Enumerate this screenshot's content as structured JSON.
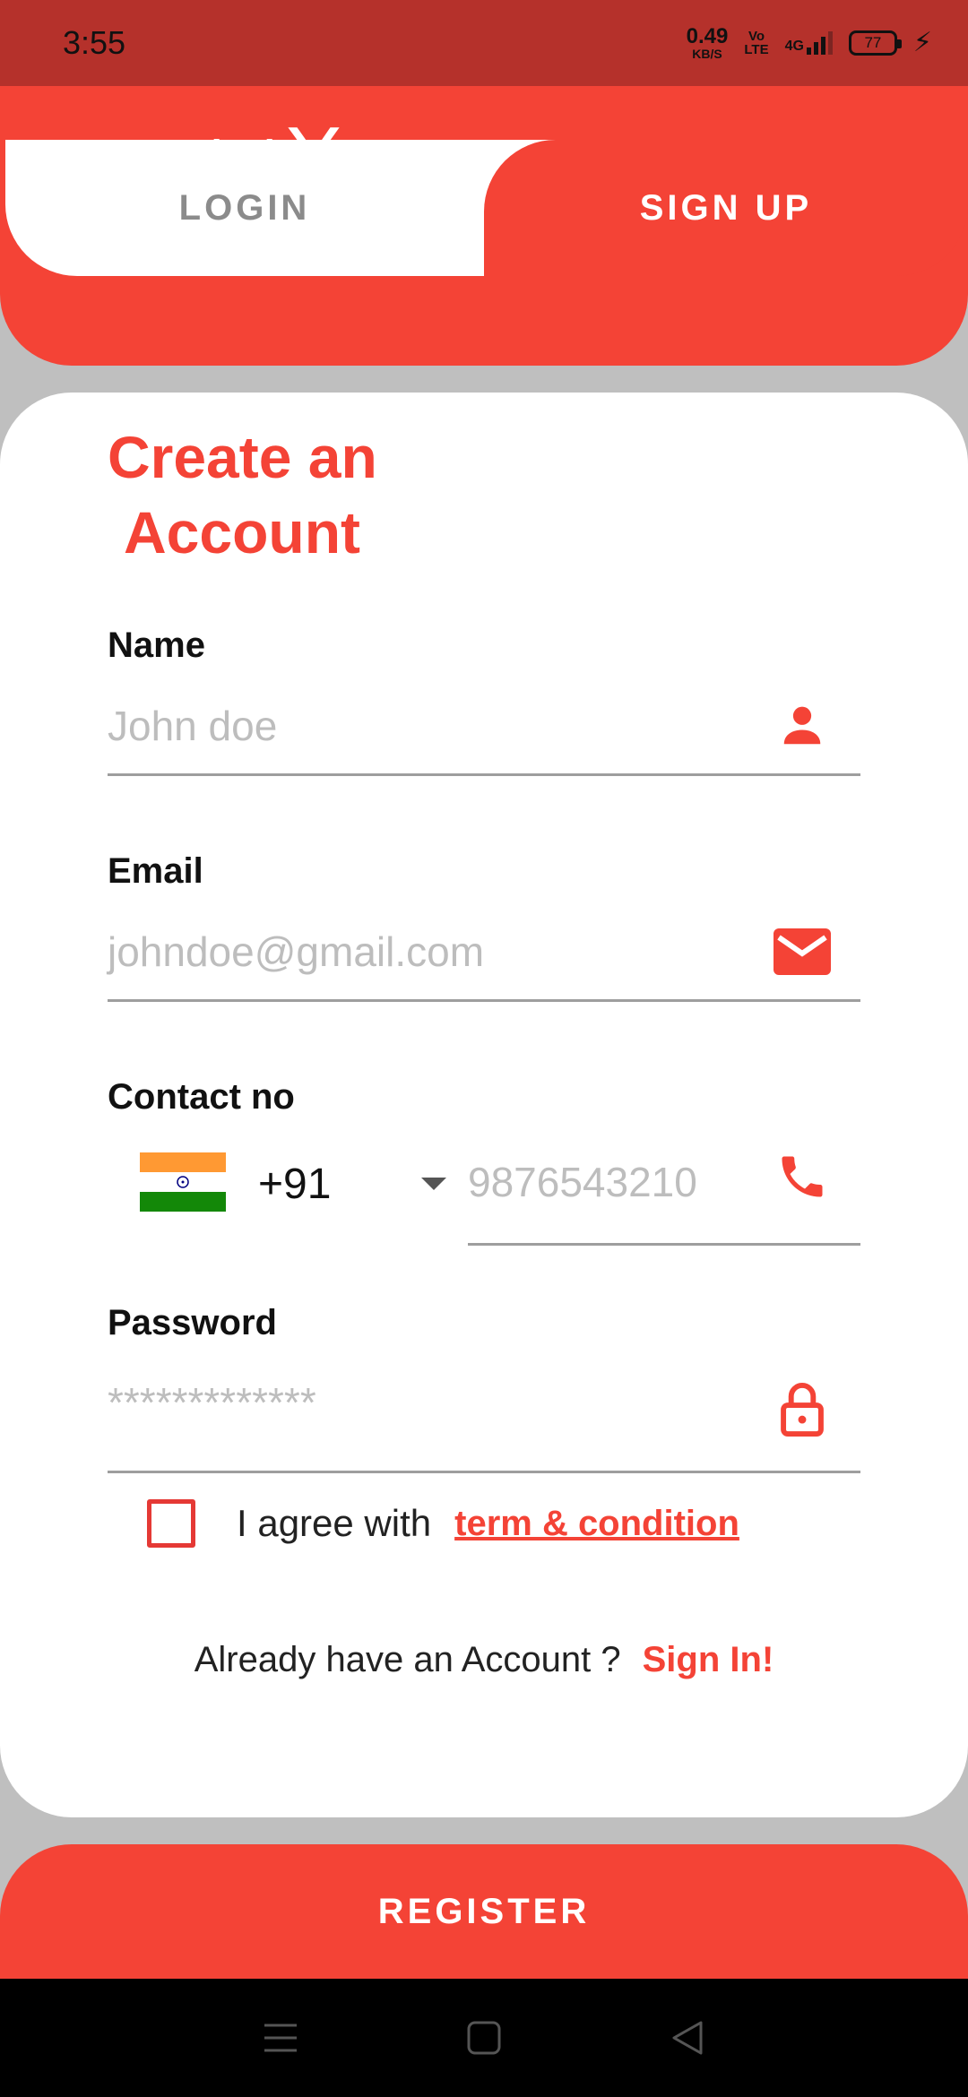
{
  "status_bar": {
    "time": "3:55",
    "net_speed_value": "0.49",
    "net_speed_unit": "KB/S",
    "volte_top": "Vo",
    "volte_bottom": "LTE",
    "network": "4G",
    "battery": "77"
  },
  "header": {
    "brand_main": "Social",
    "brand_accent": "X",
    "tabs": [
      {
        "label": "LOGIN",
        "active": false
      },
      {
        "label": "SIGN UP",
        "active": true
      }
    ]
  },
  "form": {
    "title_line1": "Create an",
    "title_line2": "Account",
    "name": {
      "label": "Name",
      "placeholder": "John doe",
      "icon": "person-icon"
    },
    "email": {
      "label": "Email",
      "placeholder": "johndoe@gmail.com",
      "icon": "mail-icon"
    },
    "contact": {
      "label": "Contact no",
      "country_code": "+91",
      "country_flag": "india-flag",
      "placeholder": "9876543210",
      "icon": "phone-icon"
    },
    "password": {
      "label": "Password",
      "placeholder": "*************",
      "icon": "lock-icon"
    },
    "agree_text": "I agree with",
    "terms_link": "term & condition",
    "signin_text": "Already have an Account ?",
    "signin_link": "Sign In!"
  },
  "register_label": "REGISTER",
  "colors": {
    "accent": "#f44336",
    "status_bar": "#b5312b",
    "placeholder": "#bdbdbd",
    "divider": "#9e9e9e"
  }
}
